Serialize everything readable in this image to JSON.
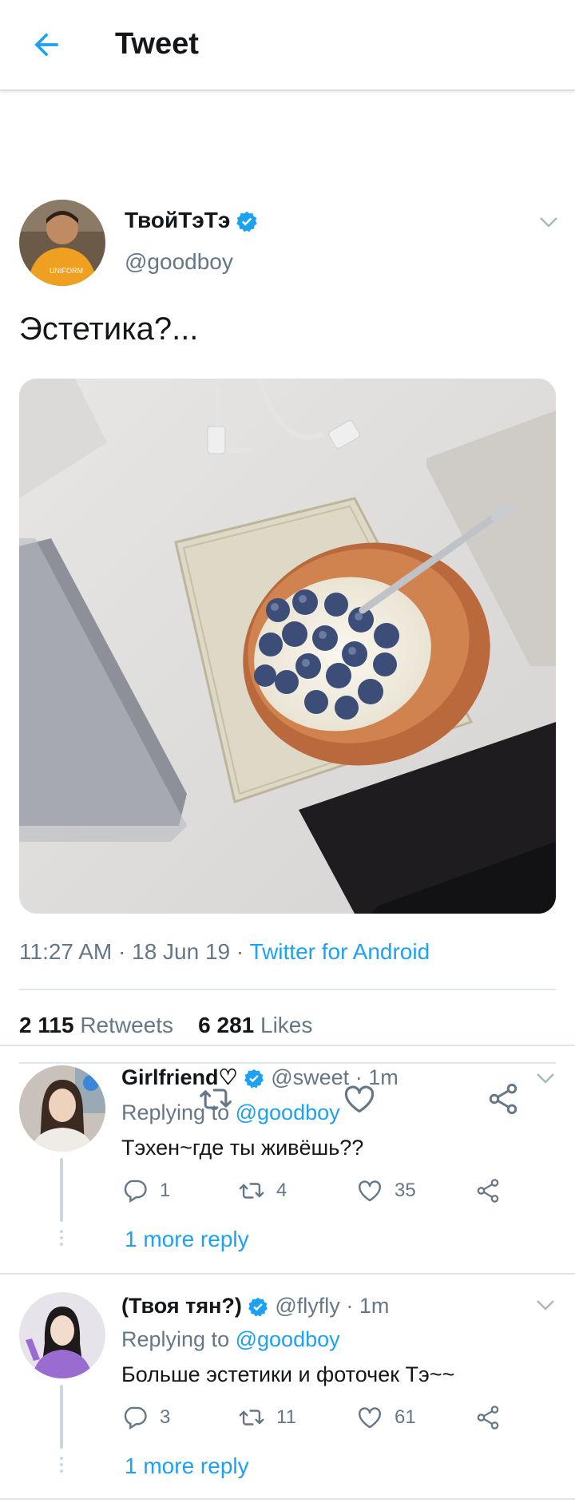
{
  "header": {
    "title": "Tweet"
  },
  "tweet": {
    "author_name": "ТвойТэТэ",
    "handle": "@goodboy",
    "text": "Эстетика?...",
    "time": "11:27 AM",
    "date": "18 Jun 19",
    "source": "Twitter for Android",
    "retweets_count": "2 115",
    "retweets_label": "Retweets",
    "likes_count": "6 281",
    "likes_label": "Likes",
    "separator": "·"
  },
  "replies": [
    {
      "name": "Girlfriend♡",
      "handle": "@sweet",
      "time": "1m",
      "replying_prefix": "Replying to",
      "replying_to": "@goodboy",
      "text": "Тэхен~где ты живёшь??",
      "reply_count": "1",
      "retweet_count": "4",
      "like_count": "35",
      "more": "1 more reply"
    },
    {
      "name": "(Твоя тян?)",
      "handle": "@flyfly",
      "time": "1m",
      "replying_prefix": "Replying to",
      "replying_to": "@goodboy",
      "text": "Больше эстетики и фоточек Тэ~~",
      "reply_count": "3",
      "retweet_count": "11",
      "like_count": "61",
      "more": "1 more reply"
    }
  ],
  "colors": {
    "accent": "#1da1f2",
    "secondary": "#657786",
    "verified": "#1da1f2"
  },
  "icons": [
    "back-arrow-icon",
    "verified-badge-icon",
    "chevron-down-icon",
    "reply-icon",
    "retweet-icon",
    "like-icon",
    "share-icon"
  ]
}
